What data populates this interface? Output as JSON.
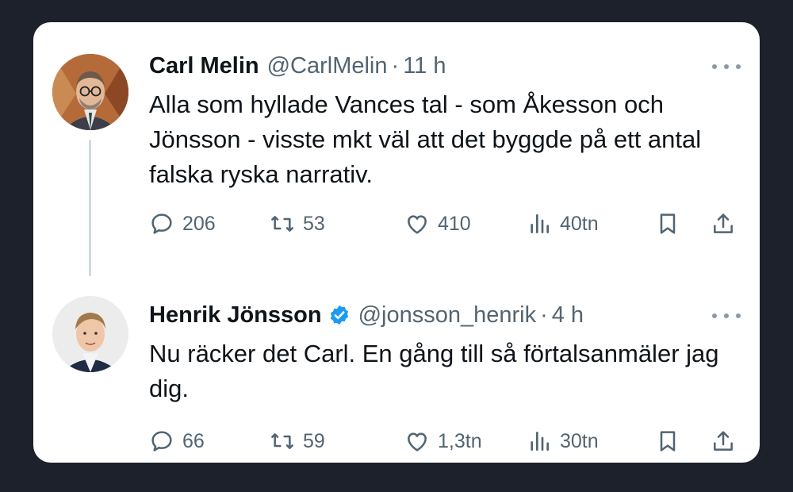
{
  "tweets": [
    {
      "display_name": "Carl Melin",
      "handle": "@CarlMelin",
      "dot": "·",
      "time": "11 h",
      "verified": false,
      "avatar_icon": "avatar-carl",
      "text": "Alla som hyllade Vances tal - som Åkesson och Jönsson - visste mkt väl att det byggde på ett antal falska ryska narrativ.",
      "replies": "206",
      "retweets": "53",
      "likes": "410",
      "views": "40tn"
    },
    {
      "display_name": "Henrik Jönsson",
      "handle": "@jonsson_henrik",
      "dot": "·",
      "time": "4 h",
      "verified": true,
      "avatar_icon": "avatar-henrik",
      "text": "Nu räcker det Carl. En gång till så förtalsanmäler jag dig.",
      "replies": "66",
      "retweets": "59",
      "likes": "1,3tn",
      "views": "30tn"
    }
  ],
  "colors": {
    "background": "#1c212b",
    "card": "#ffffff",
    "text_primary": "#0f1419",
    "text_secondary": "#536471",
    "verified_blue": "#1d9bf0",
    "thread_line": "#cfd9de"
  },
  "icons": [
    "reply-icon",
    "retweet-icon",
    "like-icon",
    "views-icon",
    "bookmark-icon",
    "share-icon",
    "more-icon",
    "verified-badge-icon"
  ]
}
